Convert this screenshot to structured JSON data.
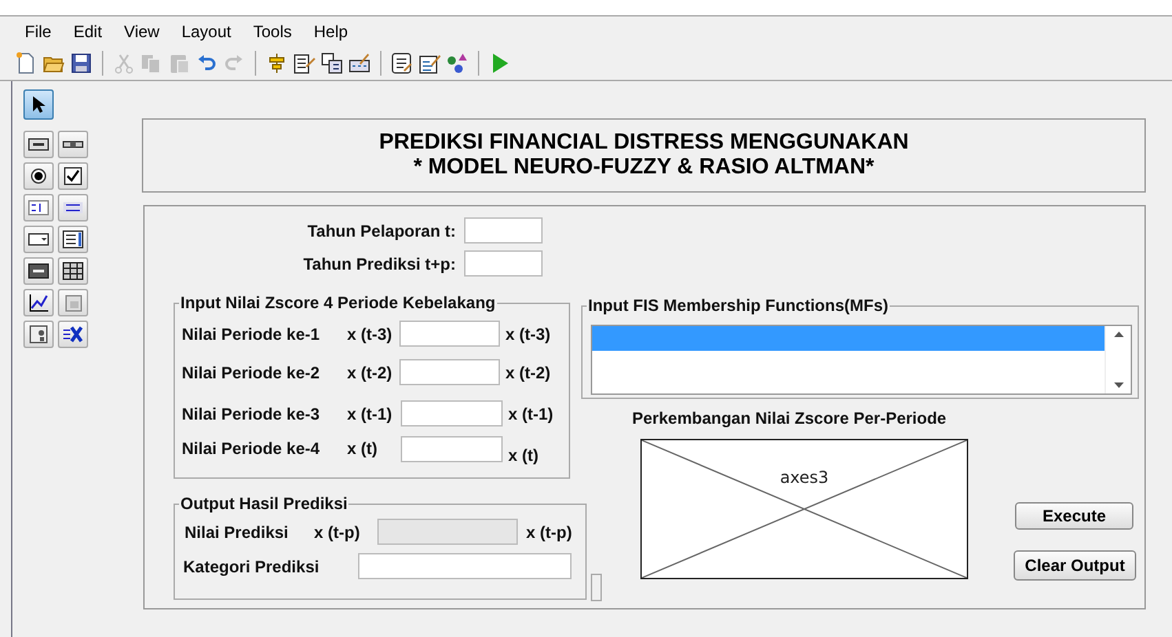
{
  "menu": [
    {
      "label": "File"
    },
    {
      "label": "Edit"
    },
    {
      "label": "View"
    },
    {
      "label": "Layout"
    },
    {
      "label": "Tools"
    },
    {
      "label": "Help"
    }
  ],
  "toolbar": [
    {
      "kind": "new",
      "disabled": false
    },
    {
      "kind": "open",
      "disabled": false
    },
    {
      "kind": "save",
      "disabled": false
    },
    {
      "kind": "sep"
    },
    {
      "kind": "cut",
      "disabled": true
    },
    {
      "kind": "copy",
      "disabled": true
    },
    {
      "kind": "paste",
      "disabled": true
    },
    {
      "kind": "undo",
      "disabled": false
    },
    {
      "kind": "redo",
      "disabled": true
    },
    {
      "kind": "sep"
    },
    {
      "kind": "align",
      "disabled": false
    },
    {
      "kind": "menuedit",
      "disabled": false
    },
    {
      "kind": "taborder",
      "disabled": false
    },
    {
      "kind": "tooledit",
      "disabled": false
    },
    {
      "kind": "sep"
    },
    {
      "kind": "editor",
      "disabled": false
    },
    {
      "kind": "inspector",
      "disabled": false
    },
    {
      "kind": "browser",
      "disabled": false
    },
    {
      "kind": "sep"
    },
    {
      "kind": "run",
      "disabled": false
    }
  ],
  "palette": [
    {
      "kind": "select",
      "selected": true
    },
    {
      "kind": "pushbutton",
      "selected": false
    },
    {
      "kind": "slider",
      "selected": false
    },
    {
      "kind": "radio",
      "selected": false
    },
    {
      "kind": "checkbox",
      "selected": false
    },
    {
      "kind": "edit",
      "selected": false
    },
    {
      "kind": "text",
      "selected": false
    },
    {
      "kind": "popup",
      "selected": false
    },
    {
      "kind": "listbox",
      "selected": false
    },
    {
      "kind": "toggle",
      "selected": false
    },
    {
      "kind": "table",
      "selected": false
    },
    {
      "kind": "axes",
      "selected": false
    },
    {
      "kind": "panel",
      "selected": false
    },
    {
      "kind": "buttongroup",
      "selected": false
    },
    {
      "kind": "activex",
      "selected": false
    }
  ],
  "title_panel": {
    "lines": [
      "PREDIKSI FINANCIAL DISTRESS MENGGUNAKAN",
      "* MODEL NEURO-FUZZY & RASIO ALTMAN*"
    ]
  },
  "year_fields": [
    {
      "label": "Tahun Pelaporan t:"
    },
    {
      "label": "Tahun Prediksi t+p:"
    }
  ],
  "zscore_group": {
    "title": "Input Nilai Zscore 4 Periode Kebelakang",
    "rows": [
      {
        "label": "Nilai Periode ke-1",
        "unit": "x (t-3)",
        "suffix": "x (t-3)"
      },
      {
        "label": "Nilai Periode ke-2",
        "unit": "x (t-2)",
        "suffix": "x (t-2)"
      },
      {
        "label": "Nilai Periode ke-3",
        "unit": "x (t-1)",
        "suffix": "x (t-1)"
      },
      {
        "label": "Nilai Periode ke-4",
        "unit": "x (t)",
        "suffix": "x (t)"
      }
    ]
  },
  "fis_group": {
    "title": "Input FIS Membership Functions(MFs)",
    "listbox": {
      "rows": [
        {
          "selected": true
        },
        {
          "selected": false
        }
      ]
    }
  },
  "axes": {
    "title": "Perkembangan Nilai Zscore Per-Periode",
    "tag": "axes3"
  },
  "output_group": {
    "title": "Output Hasil Prediksi",
    "rows": [
      {
        "label": "Nilai Prediksi",
        "unit": "x (t-p)",
        "suffix": "x (t-p)",
        "disabled": true
      },
      {
        "label": "Kategori Prediksi",
        "disabled": false
      }
    ]
  },
  "buttons": [
    {
      "label": "Execute"
    },
    {
      "label": "Clear Output"
    }
  ]
}
